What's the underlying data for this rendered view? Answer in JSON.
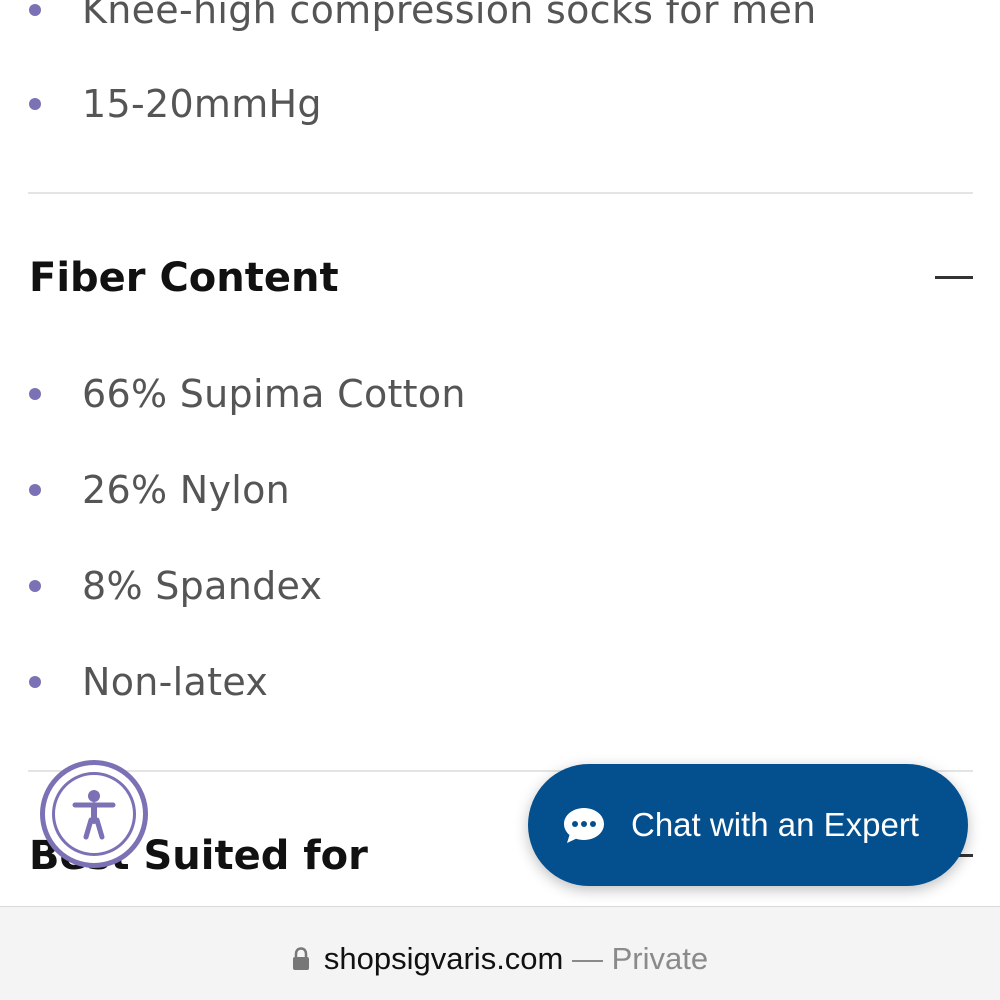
{
  "specs": {
    "items": [
      "Knee-high compression socks for men",
      "15-20mmHg"
    ]
  },
  "fiber_content": {
    "title": "Fiber Content",
    "items": [
      "66% Supima Cotton",
      "26% Nylon",
      "8% Spandex",
      "Non-latex"
    ]
  },
  "best_suited": {
    "title": "Best Suited for"
  },
  "chat": {
    "label": "Chat with an Expert"
  },
  "browser": {
    "host": "shopsigvaris.com",
    "separator": " — ",
    "mode": "Private"
  },
  "colors": {
    "accent_purple": "#7a72b5",
    "chat_blue": "#04508f"
  },
  "icons": {
    "accessibility": "accessibility-person-icon",
    "chat": "chat-bubble-icon",
    "collapse": "minus-icon",
    "lock": "lock-icon"
  }
}
